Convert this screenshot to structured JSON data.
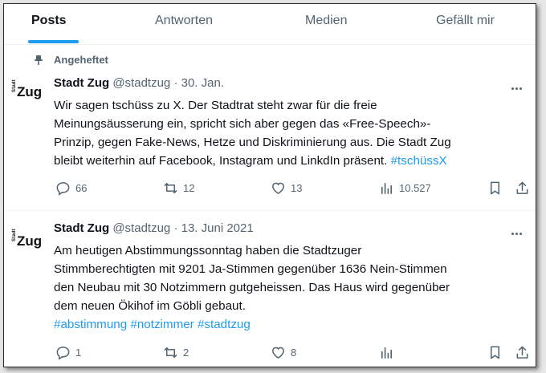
{
  "tabs": [
    {
      "label": "Posts",
      "active": true
    },
    {
      "label": "Antworten",
      "active": false
    },
    {
      "label": "Medien",
      "active": false
    },
    {
      "label": "Gefällt mir",
      "active": false
    }
  ],
  "colors": {
    "accent": "#1d9bf0",
    "muted": "#536471",
    "text": "#0f1419"
  },
  "posts": [
    {
      "pinned_label": "Angeheftet",
      "avatar_small": "Stadt",
      "avatar_big": "Zug",
      "name": "Stadt Zug",
      "handle": "@stadtzug",
      "dot": "·",
      "date": "30. Jan.",
      "lines": [
        "Wir sagen tschüss zu X. Der Stadtrat steht zwar für die freie",
        "Meinungsäusserung ein, spricht sich aber gegen das «Free-Speech»-",
        "Prinzip, gegen Fake-News, Hetze und Diskriminierung aus. Die Stadt Zug",
        "bleibt weiterhin auf Facebook, Instagram und LinkdIn  präsent. "
      ],
      "hashtag_inline": "#tschüssX",
      "replies": "66",
      "reposts": "12",
      "likes": "13",
      "views": "10.527"
    },
    {
      "avatar_small": "Stadt",
      "avatar_big": "Zug",
      "name": "Stadt Zug",
      "handle": "@stadtzug",
      "dot": "·",
      "date": "13. Juni 2021",
      "lines": [
        "Am heutigen Abstimmungssonntag haben die Stadtzuger",
        "Stimmberechtigten mit 9201 Ja-Stimmen gegenüber 1636 Nein-Stimmen",
        "den Neubau mit 30 Notzimmern gutgeheissen. Das Haus wird gegenüber",
        "dem neuen Ökihof im Göbli gebaut."
      ],
      "hashtags": "#abstimmung #notzimmer #stadtzug",
      "replies": "1",
      "reposts": "2",
      "likes": "8",
      "views": ""
    }
  ],
  "icons": [
    "pin-icon",
    "more-icon",
    "reply-icon",
    "repost-icon",
    "like-icon",
    "views-icon",
    "bookmark-icon",
    "share-icon"
  ]
}
